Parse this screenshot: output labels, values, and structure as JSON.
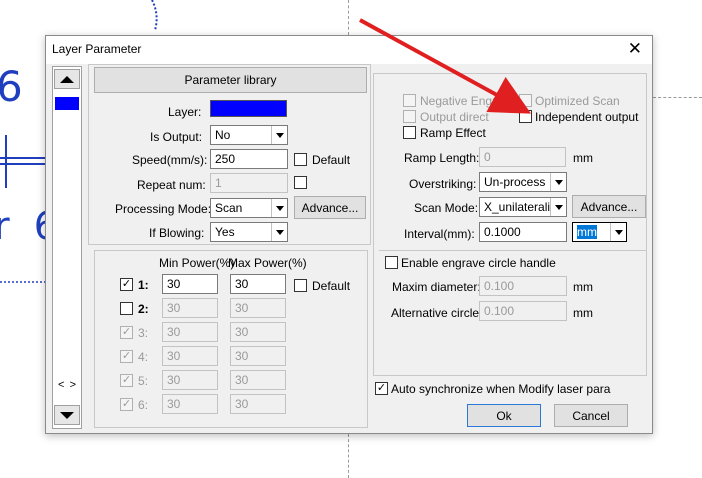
{
  "background": {
    "glyphs": [
      "6",
      "r 6"
    ]
  },
  "dialog": {
    "title": "Layer Parameter",
    "close_icon": "close-icon",
    "layer_list": {
      "scroll_up_icon": "triangle-up-icon",
      "scroll_down_icon": "triangle-down-icon",
      "h_scroll_left": "<",
      "h_scroll_right": ">",
      "layer_color": "#0000ff"
    },
    "left": {
      "parameter_library_label": "Parameter library",
      "layer_label": "Layer:",
      "layer_color": "#0000ff",
      "is_output_label": "Is Output:",
      "is_output_value": "No",
      "speed_label": "Speed(mm/s):",
      "speed_value": "250",
      "speed_default_label": "Default",
      "repeat_label": "Repeat num:",
      "repeat_value": "1",
      "processing_mode_label": "Processing Mode:",
      "processing_mode_value": "Scan",
      "advance_label": "Advance...",
      "if_blowing_label": "If Blowing:",
      "if_blowing_value": "Yes",
      "power": {
        "min_header": "Min Power(%)",
        "max_header": "Max Power(%)",
        "default_label": "Default",
        "rows": [
          {
            "label": "1:",
            "checked": true,
            "min": "30",
            "max": "30"
          },
          {
            "label": "2:",
            "checked": false,
            "min": "30",
            "max": "30"
          },
          {
            "label": "3:",
            "checked": true,
            "min": "30",
            "max": "30"
          },
          {
            "label": "4:",
            "checked": true,
            "min": "30",
            "max": "30"
          },
          {
            "label": "5:",
            "checked": true,
            "min": "30",
            "max": "30"
          },
          {
            "label": "6:",
            "checked": true,
            "min": "30",
            "max": "30"
          }
        ]
      }
    },
    "right": {
      "negative_engrave_label": "Negative Engr",
      "optimized_scan_label": "Optimized Scan",
      "output_direct_label": "Output direct",
      "independent_output_label": "Independent output",
      "ramp_effect_label": "Ramp Effect",
      "ramp_length_label": "Ramp Length:",
      "ramp_length_value": "0",
      "ramp_length_unit": "mm",
      "overstriking_label": "Overstriking:",
      "overstriking_value": "Un-process",
      "scan_mode_label": "Scan Mode:",
      "scan_mode_value": "X_unilateralisr",
      "advance_label": "Advance...",
      "interval_label": "Interval(mm):",
      "interval_value": "0.1000",
      "interval_unit_value": "mm",
      "engrave_circle_label": "Enable engrave circle handle",
      "maxim_diameter_label": "Maxim diameter:",
      "maxim_diameter_value": "0.100",
      "maxim_diameter_unit": "mm",
      "alternative_circle_label": "Alternative circle",
      "alternative_circle_value": "0.100",
      "alternative_circle_unit": "mm"
    },
    "auto_sync_label": "Auto synchronize when Modify laser para",
    "ok_label": "Ok",
    "cancel_label": "Cancel"
  },
  "annotation": {
    "arrow_color": "#e02020"
  }
}
